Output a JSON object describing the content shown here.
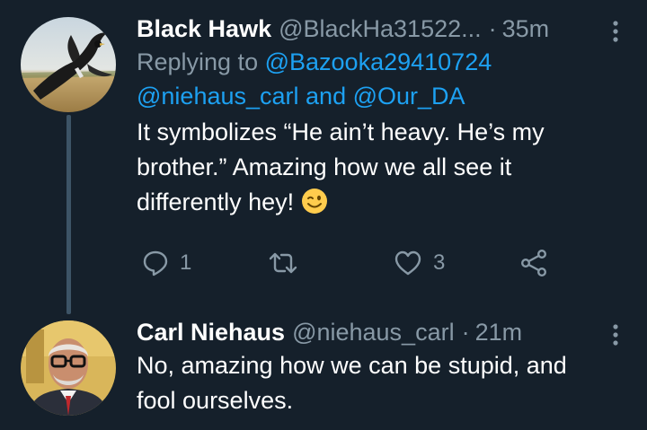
{
  "colors": {
    "background": "#15202b",
    "secondary_text": "#8899a6",
    "accent": "#1da1f2",
    "thread_line": "#3d5466"
  },
  "tweets": [
    {
      "display_name": "Black Hawk",
      "handle": "@BlackHa31522...",
      "separator": "·",
      "time": "35m",
      "replying_prefix": "Replying to",
      "reply_mention_1": "@Bazooka29410724",
      "reply_mention_2": "@niehaus_carl",
      "reply_and": "and",
      "reply_mention_3": "@Our_DA",
      "text_line_1": "It symbolizes “He ain’t heavy. He’s my",
      "text_line_2": "brother.”  Amazing how we all see it",
      "text_line_3": "differently hey!",
      "emoji": "winking-face-icon",
      "actions": {
        "reply_count": "1",
        "retweet_count": "",
        "like_count": "3"
      }
    },
    {
      "display_name": "Carl Niehaus",
      "handle": "@niehaus_carl",
      "separator": "·",
      "time": "21m",
      "text_line_1": "No, amazing how we can be stupid, and",
      "text_line_2": "fool ourselves."
    }
  ]
}
